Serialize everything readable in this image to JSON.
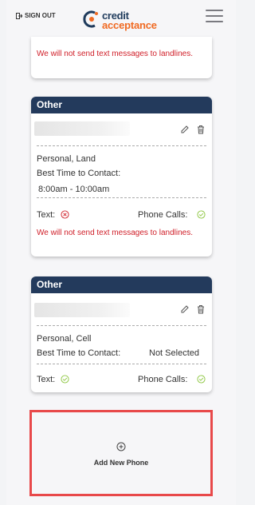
{
  "header": {
    "signout_label": "SIGN OUT",
    "logo_line1": "credit",
    "logo_line2": "acceptance",
    "brand_colors": {
      "navy": "#1f3b5c",
      "orange": "#f06a22"
    }
  },
  "top_card": {
    "warning": "We will not send text messages to landlines."
  },
  "cards": [
    {
      "title": "Other",
      "type_label": "Personal, Land",
      "best_time_label": "Best Time to Contact:",
      "best_time_value": "8:00am - 10:00am",
      "text_label": "Text:",
      "text_status": "not-allowed",
      "calls_label": "Phone Calls:",
      "calls_status": "allowed",
      "warning": "We will not send text messages to landlines."
    },
    {
      "title": "Other",
      "type_label": "Personal, Cell",
      "best_time_label": "Best Time to Contact:",
      "best_time_value": "Not Selected",
      "text_label": "Text:",
      "text_status": "allowed",
      "calls_label": "Phone Calls:",
      "calls_status": "allowed"
    }
  ],
  "add_phone": {
    "label": "Add New Phone"
  },
  "colors": {
    "card_header": "#233a5c",
    "warning": "#d0202a",
    "ok": "#8cc63f",
    "error": "#d0202a",
    "highlight": "#e8494a"
  }
}
